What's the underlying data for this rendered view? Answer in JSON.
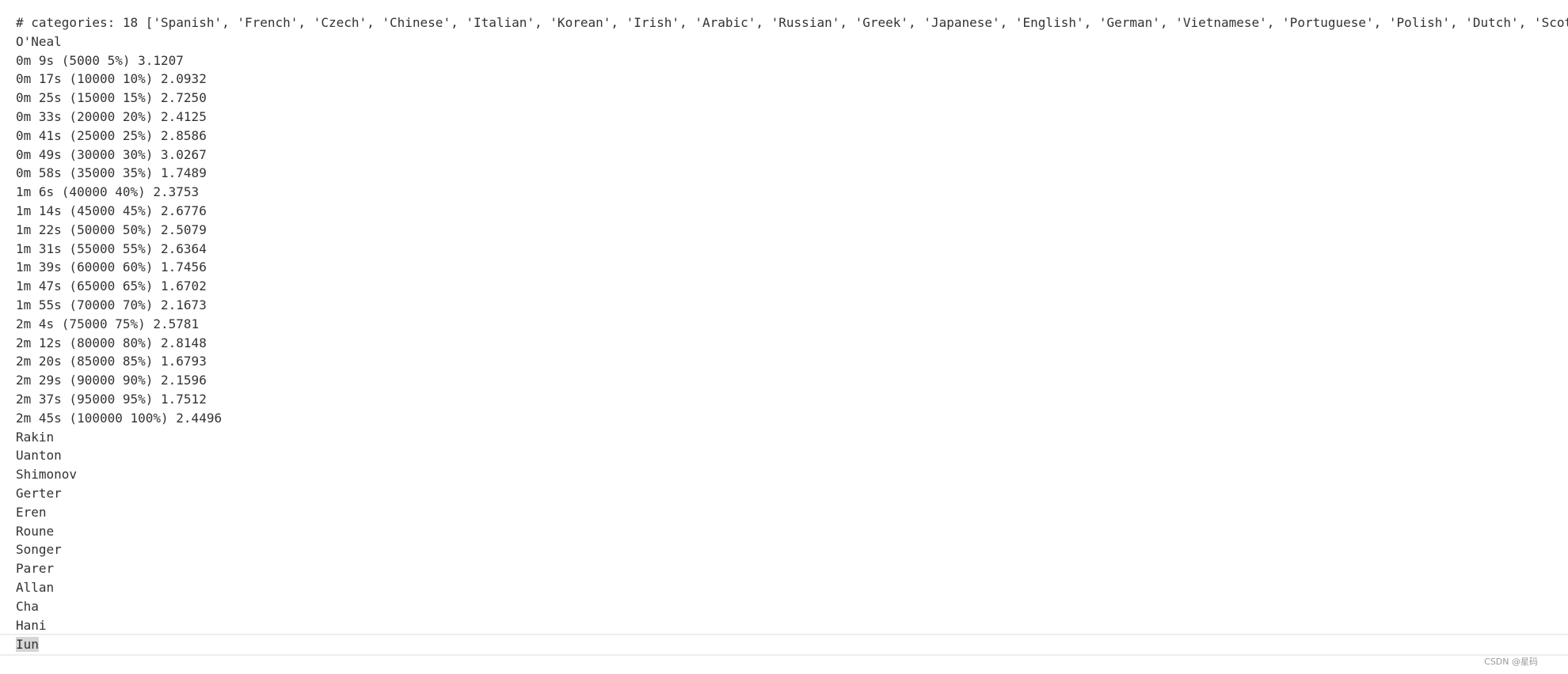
{
  "output": {
    "lines": [
      "# categories: 18 ['Spanish', 'French', 'Czech', 'Chinese', 'Italian', 'Korean', 'Irish', 'Arabic', 'Russian', 'Greek', 'Japanese', 'English', 'German', 'Vietnamese', 'Portuguese', 'Polish', 'Dutch', 'Scot",
      "O'Neal",
      "0m 9s (5000 5%) 3.1207",
      "0m 17s (10000 10%) 2.0932",
      "0m 25s (15000 15%) 2.7250",
      "0m 33s (20000 20%) 2.4125",
      "0m 41s (25000 25%) 2.8586",
      "0m 49s (30000 30%) 3.0267",
      "0m 58s (35000 35%) 1.7489",
      "1m 6s (40000 40%) 2.3753",
      "1m 14s (45000 45%) 2.6776",
      "1m 22s (50000 50%) 2.5079",
      "1m 31s (55000 55%) 2.6364",
      "1m 39s (60000 60%) 1.7456",
      "1m 47s (65000 65%) 1.6702",
      "1m 55s (70000 70%) 2.1673",
      "2m 4s (75000 75%) 2.5781",
      "2m 12s (80000 80%) 2.8148",
      "2m 20s (85000 85%) 1.6793",
      "2m 29s (90000 90%) 2.1596",
      "2m 37s (95000 95%) 1.7512",
      "2m 45s (100000 100%) 2.4496",
      "Rakin",
      "Uanton",
      "Shimonov",
      "Gerter",
      "Eren",
      "Roune",
      "Songer",
      "Parer",
      "Allan",
      "Cha",
      "Hani"
    ],
    "active_line": "Iun"
  },
  "watermark": "CSDN @星码"
}
